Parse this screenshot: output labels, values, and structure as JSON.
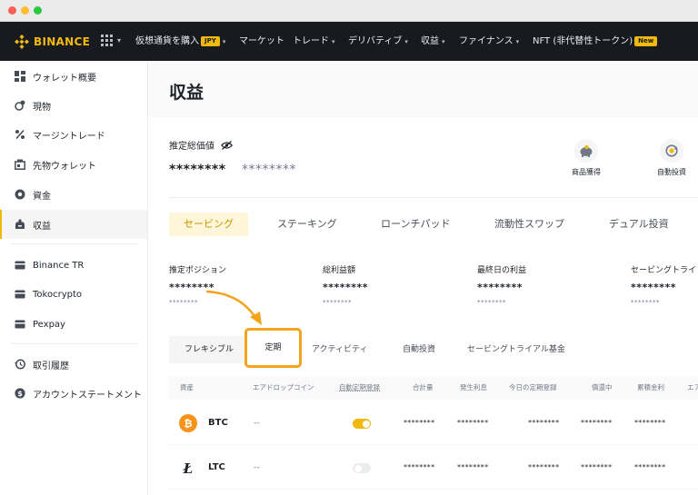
{
  "nav": {
    "brand": "BINANCE",
    "items": [
      {
        "label": "仮想通貨を購入",
        "badge": "JPY",
        "has_caret": true
      },
      {
        "label": "マーケット",
        "has_caret": false
      },
      {
        "label": "トレード",
        "has_caret": true
      },
      {
        "label": "デリバティブ",
        "has_caret": true
      },
      {
        "label": "収益",
        "has_caret": true
      },
      {
        "label": "ファイナンス",
        "has_caret": true
      },
      {
        "label": "NFT (非代替性トークン)",
        "badge": "New",
        "has_caret": false
      }
    ],
    "caret": "▾",
    "colors": {
      "background": "#181a20",
      "brand": "#f0b90b"
    }
  },
  "sidebar": {
    "items": [
      {
        "label": "ウォレット概要",
        "icon": "dashboard-icon"
      },
      {
        "label": "現物",
        "icon": "spot-icon"
      },
      {
        "label": "マージントレード",
        "icon": "percent-icon"
      },
      {
        "label": "先物ウォレット",
        "icon": "futures-icon"
      },
      {
        "label": "資金",
        "icon": "funding-icon"
      },
      {
        "label": "収益",
        "icon": "earn-icon",
        "active": true
      },
      {
        "label": "Binance TR",
        "icon": "wallet-icon"
      },
      {
        "label": "Tokocrypto",
        "icon": "wallet-icon"
      },
      {
        "label": "Pexpay",
        "icon": "wallet-icon"
      },
      {
        "label": "取引履歴",
        "icon": "history-icon"
      },
      {
        "label": "アカウントステートメント",
        "icon": "dollar-icon"
      }
    ]
  },
  "main": {
    "title": "収益",
    "estimated": {
      "label": "推定総価値",
      "value": "********",
      "value_secondary": "********"
    },
    "quick_actions": [
      {
        "label": "商品獲得",
        "icon": "piggy-bank-icon"
      },
      {
        "label": "自動投資",
        "icon": "auto-invest-icon"
      }
    ],
    "tabs": [
      "セービング",
      "ステーキング",
      "ローンチパッド",
      "流動性スワップ",
      "デュアル投資"
    ],
    "active_tab": "セービング",
    "stats": [
      {
        "label": "推定ポジション",
        "value": "********",
        "sub": "********"
      },
      {
        "label": "総利益額",
        "value": "********",
        "sub": "********"
      },
      {
        "label": "最終日の利益",
        "value": "********",
        "sub": "********"
      },
      {
        "label": "セービングトライ",
        "value": "********",
        "sub": "********"
      }
    ],
    "subtabs": [
      "フレキシブル",
      "定期",
      "アクティビティ",
      "自動投資",
      "セービングトライアル基金"
    ],
    "highlighted_subtab": "定期",
    "table": {
      "headers": [
        "資産",
        "エアドロップコイン",
        "自動定期登録",
        "合計量",
        "発生利息",
        "今日の定期登録",
        "償還中",
        "累積金利",
        "エア"
      ],
      "rows": [
        {
          "coin": "BTC",
          "icon": "btc-icon",
          "airdrop": "--",
          "auto_subscribe": true,
          "total": "********",
          "interest": "********",
          "today": "********",
          "redeeming": "********",
          "cumulative": "********"
        },
        {
          "coin": "LTC",
          "icon": "ltc-icon",
          "airdrop": "--",
          "auto_subscribe": false,
          "total": "********",
          "interest": "********",
          "today": "********",
          "redeeming": "********",
          "cumulative": "********"
        }
      ]
    },
    "colors": {
      "accent": "#f0b90b",
      "highlight": "#f3a41b",
      "btc": "#f7931a",
      "ltc": "#1e2329"
    }
  }
}
